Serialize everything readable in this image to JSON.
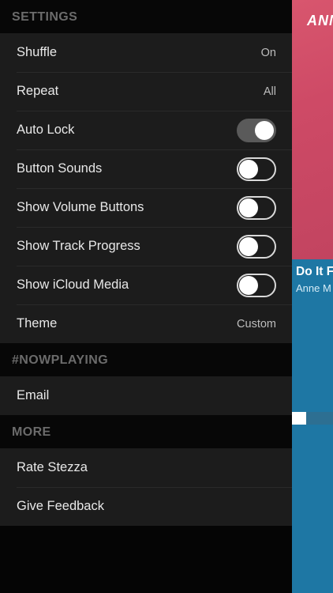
{
  "settings": {
    "header": "SETTINGS",
    "rows": [
      {
        "label": "Shuffle",
        "value": "On"
      },
      {
        "label": "Repeat",
        "value": "All"
      },
      {
        "label": "Auto Lock",
        "toggle": true
      },
      {
        "label": "Button Sounds",
        "toggle": false
      },
      {
        "label": "Show Volume Buttons",
        "toggle": false
      },
      {
        "label": "Show Track Progress",
        "toggle": false
      },
      {
        "label": "Show iCloud Media",
        "toggle": false
      },
      {
        "label": "Theme",
        "value": "Custom"
      }
    ]
  },
  "nowplaying": {
    "header": "#NOWPLAYING",
    "rows": [
      {
        "label": "Email"
      }
    ]
  },
  "more": {
    "header": "MORE",
    "rows": [
      {
        "label": "Rate Stezza"
      },
      {
        "label": "Give Feedback"
      }
    ]
  },
  "player": {
    "artwork_text": "ANN",
    "track_title": "Do It F",
    "track_artist": "Anne M",
    "progress_fraction": 0.35
  },
  "colors": {
    "drawer_background": "#050505",
    "row_background": "#1c1c1c",
    "player_background": "#1e77a4",
    "artwork_pink": "#d14d68"
  }
}
